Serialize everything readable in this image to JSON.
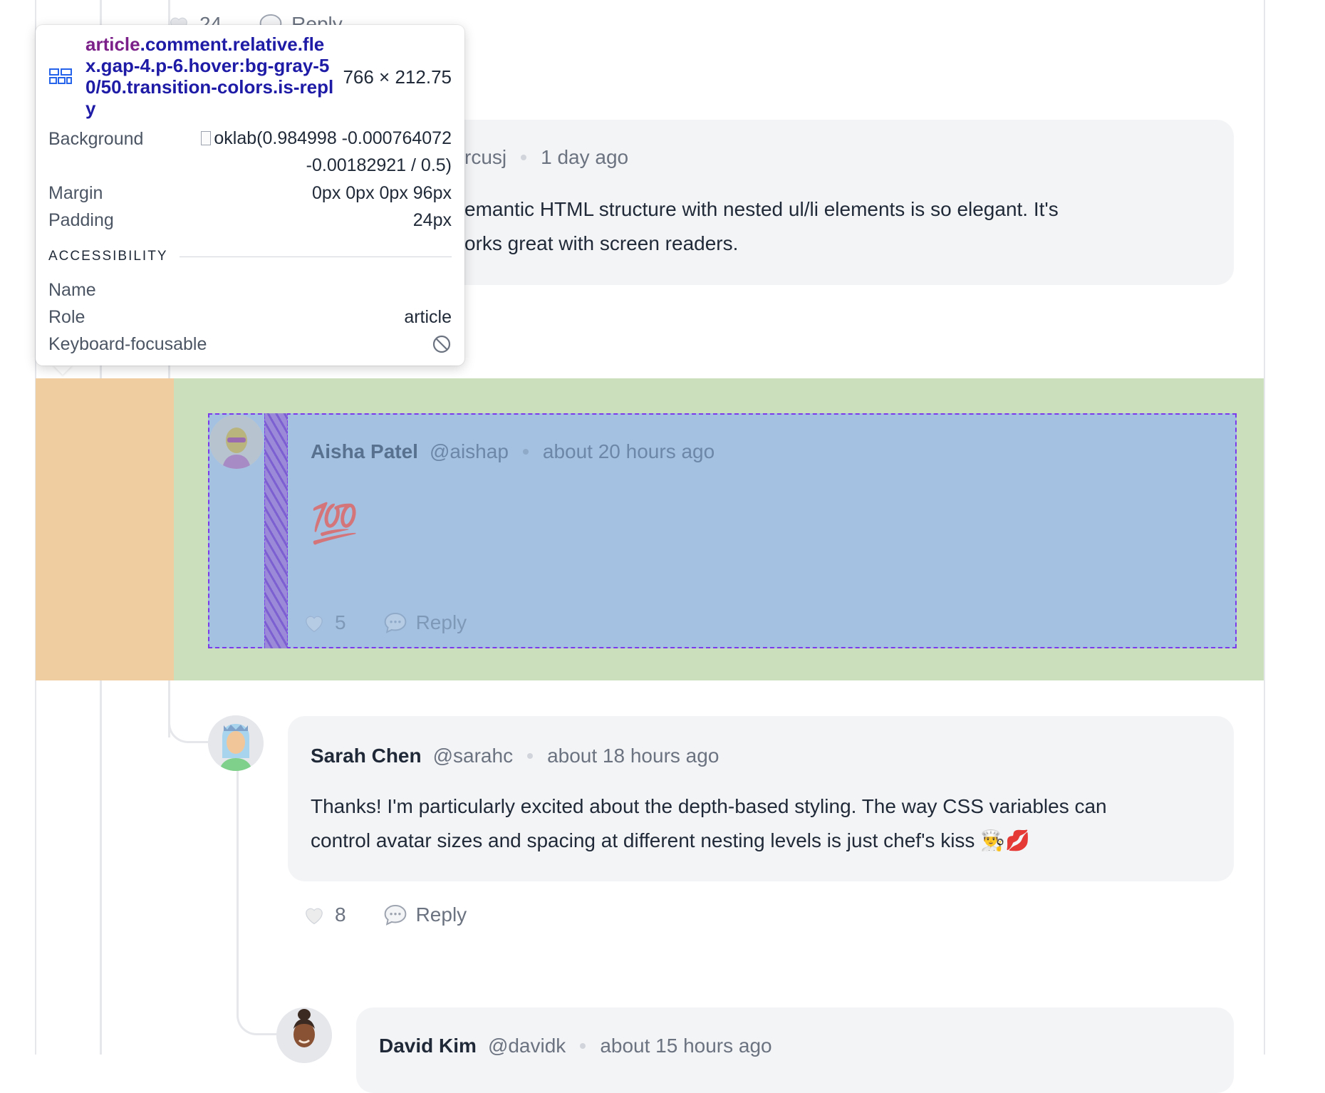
{
  "top_comment": {
    "likes": "24",
    "reply_label": "Reply"
  },
  "comment_marcus": {
    "handle_partial": "rcusj",
    "time": "1 day ago",
    "text_line1": "emantic HTML structure with nested ul/li elements is so elegant. It's",
    "text_line2": "orks great with screen readers."
  },
  "comment_aisha": {
    "author": "Aisha Patel",
    "handle": "@aishap",
    "time": "about 20 hours ago",
    "text": "💯",
    "likes": "5",
    "reply_label": "Reply"
  },
  "comment_sarah": {
    "author": "Sarah Chen",
    "handle": "@sarahc",
    "time": "about 18 hours ago",
    "text_line1": "Thanks! I'm particularly excited about the depth-based styling. The way CSS variables can",
    "text_line2": "control avatar sizes and spacing at different nesting levels is just chef's kiss 👨‍🍳💋",
    "likes": "8",
    "reply_label": "Reply"
  },
  "comment_david": {
    "author": "David Kim",
    "handle": "@davidk",
    "time": "about 15 hours ago"
  },
  "inspector": {
    "selector_tag": "article",
    "selector_classes": ".comment.relative.flex.gap-4.p-6.hover:bg-gray-50/50.transition-colors.is-reply",
    "size": "766 × 212.75",
    "background_label": "Background",
    "background_value_line1": "oklab(0.984998 -0.000764072",
    "background_value_line2": "-0.00182921 / 0.5)",
    "margin_label": "Margin",
    "margin_value": "0px 0px 0px 96px",
    "padding_label": "Padding",
    "padding_value": "24px",
    "section_title": "ACCESSIBILITY",
    "name_label": "Name",
    "name_value": "",
    "role_label": "Role",
    "role_value": "article",
    "focusable_label": "Keyboard-focusable",
    "focusable_icon": "not-allowed-icon"
  },
  "colors": {
    "margin_overlay": "#f0cda0",
    "element_overlay": "#ccdfbc",
    "content_overlay": "#a4c1e2",
    "gap_overlay": "#7c3aed",
    "bubble": "#f3f4f6",
    "selector_tag": "#7b2089",
    "selector_class": "#1e1ba6"
  }
}
